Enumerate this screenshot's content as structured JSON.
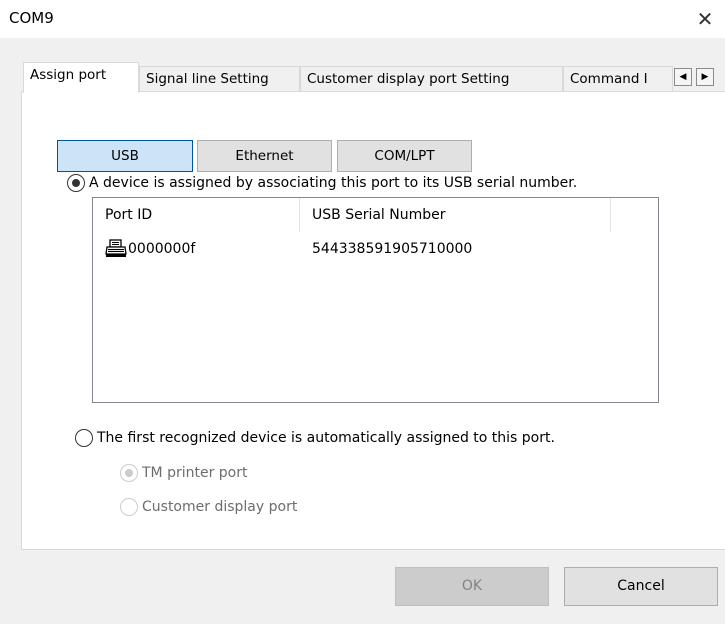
{
  "window": {
    "title": "COM9"
  },
  "tabs": [
    {
      "label": "Assign port"
    },
    {
      "label": "Signal line Setting"
    },
    {
      "label": "Customer display port Setting"
    },
    {
      "label": "Command I"
    }
  ],
  "connection_buttons": [
    {
      "label": "USB",
      "selected": true
    },
    {
      "label": "Ethernet",
      "selected": false
    },
    {
      "label": "COM/LPT",
      "selected": false
    }
  ],
  "assign_options": {
    "by_serial": {
      "label": "A device is assigned by associating this port to its USB serial number.",
      "checked": true
    },
    "first_recognized": {
      "label": "The first recognized device is automatically assigned to this port.",
      "checked": false
    },
    "sub_options": [
      {
        "label": "TM printer port",
        "checked": true,
        "enabled": false
      },
      {
        "label": "Customer display port",
        "checked": false,
        "enabled": false
      }
    ]
  },
  "device_list": {
    "columns": [
      "Port ID",
      "USB Serial Number"
    ],
    "rows": [
      {
        "icon": "printer-icon",
        "port_id": "0000000f",
        "serial": "544338591905710000"
      }
    ]
  },
  "buttons": {
    "ok": "OK",
    "cancel": "Cancel"
  },
  "colors": {
    "selected_button": "#cce4f7",
    "selected_border": "#005499"
  }
}
